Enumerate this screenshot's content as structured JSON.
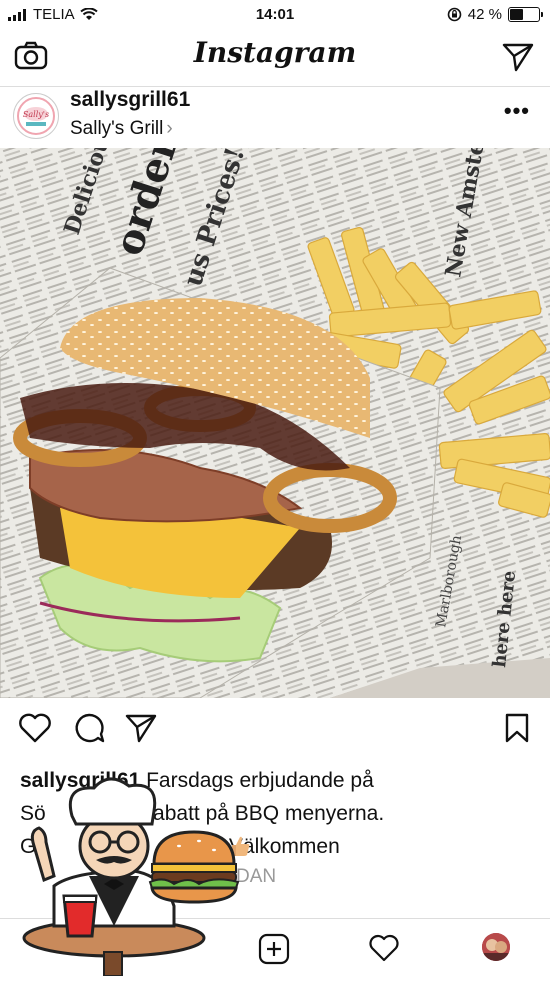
{
  "status_bar": {
    "carrier": "TELIA",
    "time": "14:01",
    "battery_text": "42 %",
    "battery_level": 0.42
  },
  "nav": {
    "title": "Instagram",
    "camera_icon": "camera-icon",
    "send_icon": "send-icon"
  },
  "post": {
    "username": "sallysgrill61",
    "location": "Sally's Grill",
    "location_chevron": "›",
    "more": "•••",
    "avatar_text": "Sally's",
    "caption_user": "sallysgrill61",
    "caption_line1": "Farsdags erbjudande på",
    "caption_line2": "Sö            0:- rabatt på BBQ menyerna.",
    "caption_line3": "Gä                               Välkommen",
    "time_ago": "DAN"
  },
  "newspaper_text": {
    "a": "Delicious New",
    "b": "order!",
    "c": "us Prices!",
    "d": "New Amsterdam",
    "e": "Marlborough",
    "f": "here here"
  },
  "colors": {
    "accent": "#111111",
    "muted": "#999999",
    "divider": "#dddddd"
  }
}
